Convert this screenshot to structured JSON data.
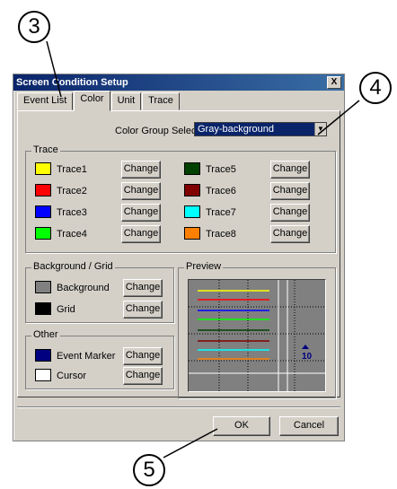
{
  "callouts": [
    "3",
    "4",
    "5"
  ],
  "dialog": {
    "title": "Screen Condition Setup",
    "close_label": "X",
    "tabs": [
      "Event List",
      "Color",
      "Unit",
      "Trace"
    ],
    "active_tab": "Color",
    "color_group_label": "Color Group Select",
    "color_group_value": "Gray-background",
    "trace_group_label": "Trace",
    "traces": [
      {
        "label": "Trace1",
        "color": "#ffff00"
      },
      {
        "label": "Trace2",
        "color": "#ff0000"
      },
      {
        "label": "Trace3",
        "color": "#0000ff"
      },
      {
        "label": "Trace4",
        "color": "#00ff00"
      },
      {
        "label": "Trace5",
        "color": "#004000"
      },
      {
        "label": "Trace6",
        "color": "#800000"
      },
      {
        "label": "Trace7",
        "color": "#00ffff"
      },
      {
        "label": "Trace8",
        "color": "#ff8000"
      }
    ],
    "change_label": "Change",
    "bg_group_label": "Background / Grid",
    "bg_items": [
      {
        "label": "Background",
        "color": "#808080"
      },
      {
        "label": "Grid",
        "color": "#000000"
      }
    ],
    "other_group_label": "Other",
    "other_items": [
      {
        "label": "Event Marker",
        "color": "#000080"
      },
      {
        "label": "Cursor",
        "color": "#ffffff"
      }
    ],
    "preview_label": "Preview",
    "preview_marker_text": "10",
    "ok_label": "OK",
    "cancel_label": "Cancel"
  }
}
